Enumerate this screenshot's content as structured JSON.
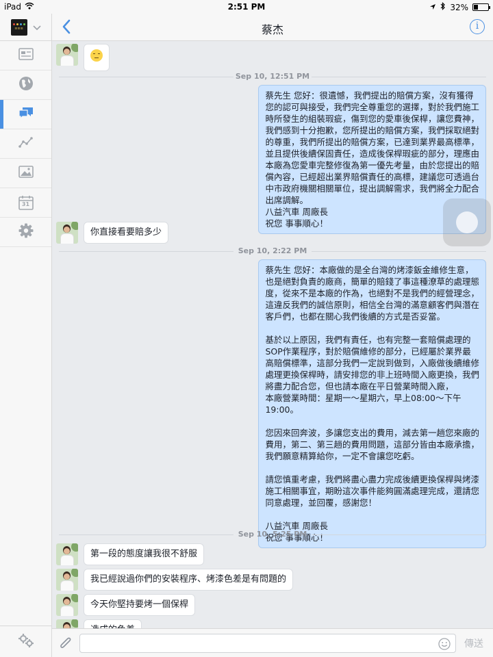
{
  "status_bar": {
    "device": "iPad",
    "time": "2:51 PM",
    "battery": "32%",
    "battery_level": 0.32
  },
  "header": {
    "title": "蔡杰"
  },
  "sidebar": {
    "items": [
      {
        "icon": "news-feed-icon"
      },
      {
        "icon": "globe-icon"
      },
      {
        "icon": "messages-icon",
        "active": true
      },
      {
        "icon": "insights-icon"
      },
      {
        "icon": "photos-icon"
      },
      {
        "icon": "calendar-icon",
        "label": "31"
      },
      {
        "icon": "settings-icon"
      }
    ]
  },
  "conversation": {
    "stamps": [
      "Sep 10, 12:51 PM",
      "Sep 10, 2:22 PM",
      "Sep 10, 5:25 PM"
    ],
    "incoming": [
      "你直接看要賠多少",
      "第一段的態度讓我很不舒服",
      "我已經說過你們的安裝程序、烤漆色差是有問題的",
      "今天你堅持要烤一個保桿",
      "造成的色差"
    ],
    "outgoing": [
      "蔡先生 您好：很遺憾，我們提出的賠償方案，沒有獲得\n您的認可與接受，我們完全尊重您的選擇，對於我們施工\n時所發生的組裝瑕疵，傷到您的愛車後保桿，讓您費神，\n我們感到十分抱歉，您所提出的賠償方案，我們採取絕對\n的尊重，我們所提出的賠償方案，已達到業界最高標準，\n並且提供後續保固責任，造成後保桿瑕疵的部分，理應由\n本廠為您愛車完整修復為第一優先考量，由於您提出的賠\n償內容，已經超出業界賠償責任的高標，建議您可透過台\n中市政府機關相關單位，提出調解需求，我們將全力配合\n出席調解。\n八益汽車 周廠長\n祝您 事事順心！",
      "蔡先生 您好：本廠做的是全台灣的烤漆鈑金維修生意，\n也是絕對負責的廠商，簡單的賠錢了事這種潦草的處理態\n度，從來不是本廠的作為，也絕對不是我們的經營理念，\n這違反我們的誠信原則，相信全台灣的滿意顧客們與潛在\n客戶們，也都在關心我們後續的方式是否妥當。\n\n基於以上原因，我們有責任，也有完整一套賠償處理的\nSOP作業程序，對於賠償維修的部分，已經屬於業界最\n高賠償標準，這部分我們一定說到做到，入廠做後續維修\n處理更換保桿時，請安排您的非上班時間入廠更換，我們\n將盡力配合您，但也請本廠在平日營業時間入廠，\n本廠營業時間：星期一～星期六，早上08:00～下午\n19:00。\n\n您因來回奔波，多讓您支出的費用，減去第一趟您來廠的\n費用，第二、第三趟的費用問題，這部分皆由本廠承擔，\n我們願意精算給你，一定不會讓您吃虧。\n\n請您慎重考慮，我們將盡心盡力完成後續更換保桿與烤漆\n施工相關事宜，期盼這次事件能夠圓滿處理完成，還請您\n同意處理，並回覆，感謝您！\n\n八益汽車 周廠長\n祝您 事事順心！"
    ]
  },
  "composer": {
    "placeholder": "",
    "send_label": "傳送"
  },
  "colors": {
    "accent": "#4a90e2",
    "outgoing_bubble": "#cde4ff",
    "background": "#e9ebee"
  }
}
